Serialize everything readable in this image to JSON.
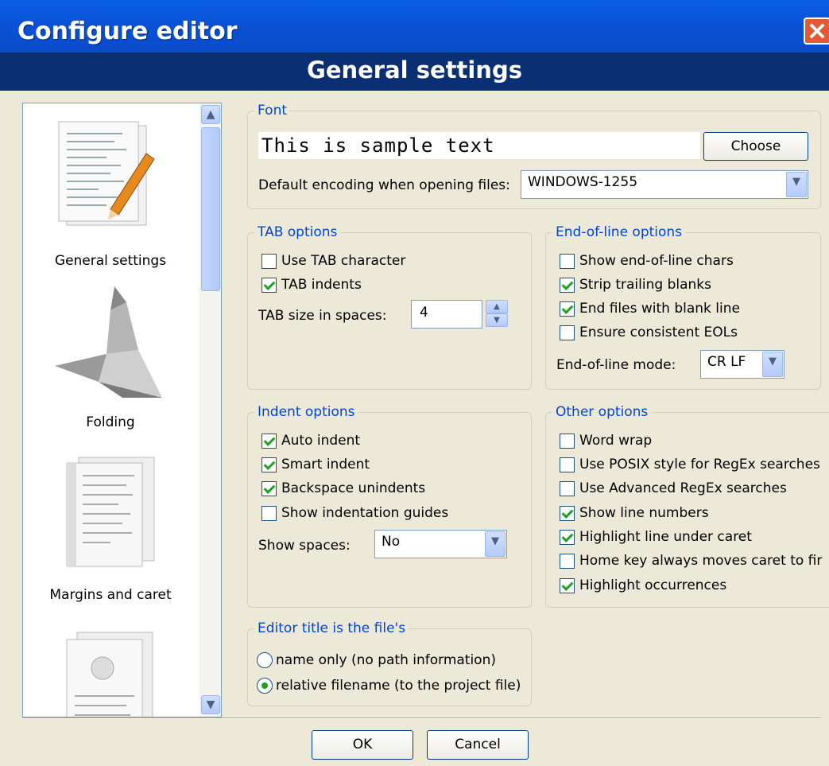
{
  "window": {
    "title": "Configure editor",
    "page_title": "General settings"
  },
  "sidebar": {
    "items": [
      {
        "label": "General settings",
        "icon": "general-settings-icon"
      },
      {
        "label": "Folding",
        "icon": "folding-icon"
      },
      {
        "label": "Margins and caret",
        "icon": "margins-caret-icon"
      },
      {
        "label": "",
        "icon": "document-icon"
      }
    ]
  },
  "font": {
    "legend": "Font",
    "sample_text": "This is sample text",
    "choose_label": "Choose",
    "encoding_label": "Default encoding when opening files:",
    "encoding_value": "WINDOWS-1255"
  },
  "tab_options": {
    "legend": "TAB options",
    "use_tab_char": {
      "label": "Use TAB character",
      "checked": false
    },
    "tab_indents": {
      "label": "TAB indents",
      "checked": true
    },
    "tab_size_label": "TAB size in spaces:",
    "tab_size_value": "4"
  },
  "eol_options": {
    "legend": "End-of-line options",
    "show_eol": {
      "label": "Show end-of-line chars",
      "checked": false
    },
    "strip_trailing": {
      "label": "Strip trailing blanks",
      "checked": true
    },
    "end_blank_line": {
      "label": "End files with blank line",
      "checked": true
    },
    "consistent_eol": {
      "label": "Ensure consistent EOLs",
      "checked": false
    },
    "mode_label": "End-of-line mode:",
    "mode_value": "CR LF"
  },
  "indent_options": {
    "legend": "Indent options",
    "auto_indent": {
      "label": "Auto indent",
      "checked": true
    },
    "smart_indent": {
      "label": "Smart indent",
      "checked": true
    },
    "backspace_unindents": {
      "label": "Backspace unindents",
      "checked": true
    },
    "indent_guides": {
      "label": "Show indentation guides",
      "checked": false
    },
    "show_spaces_label": "Show spaces:",
    "show_spaces_value": "No"
  },
  "other_options": {
    "legend": "Other options",
    "word_wrap": {
      "label": "Word wrap",
      "checked": false
    },
    "posix_regex": {
      "label": "Use POSIX style for RegEx searches",
      "checked": false
    },
    "advanced_regex": {
      "label": "Use Advanced RegEx searches",
      "checked": false
    },
    "line_numbers": {
      "label": "Show line numbers",
      "checked": true
    },
    "highlight_line": {
      "label": "Highlight line under caret",
      "checked": true
    },
    "home_key": {
      "label": "Home key always moves caret to fir",
      "checked": false
    },
    "highlight_occ": {
      "label": "Highlight occurrences",
      "checked": true
    }
  },
  "title_options": {
    "legend": "Editor title is the file's",
    "name_only": {
      "label": "name only (no path information)",
      "checked": false
    },
    "relative": {
      "label": "relative filename (to the project file)",
      "checked": true
    }
  },
  "footer": {
    "ok_label": "OK",
    "cancel_label": "Cancel"
  }
}
